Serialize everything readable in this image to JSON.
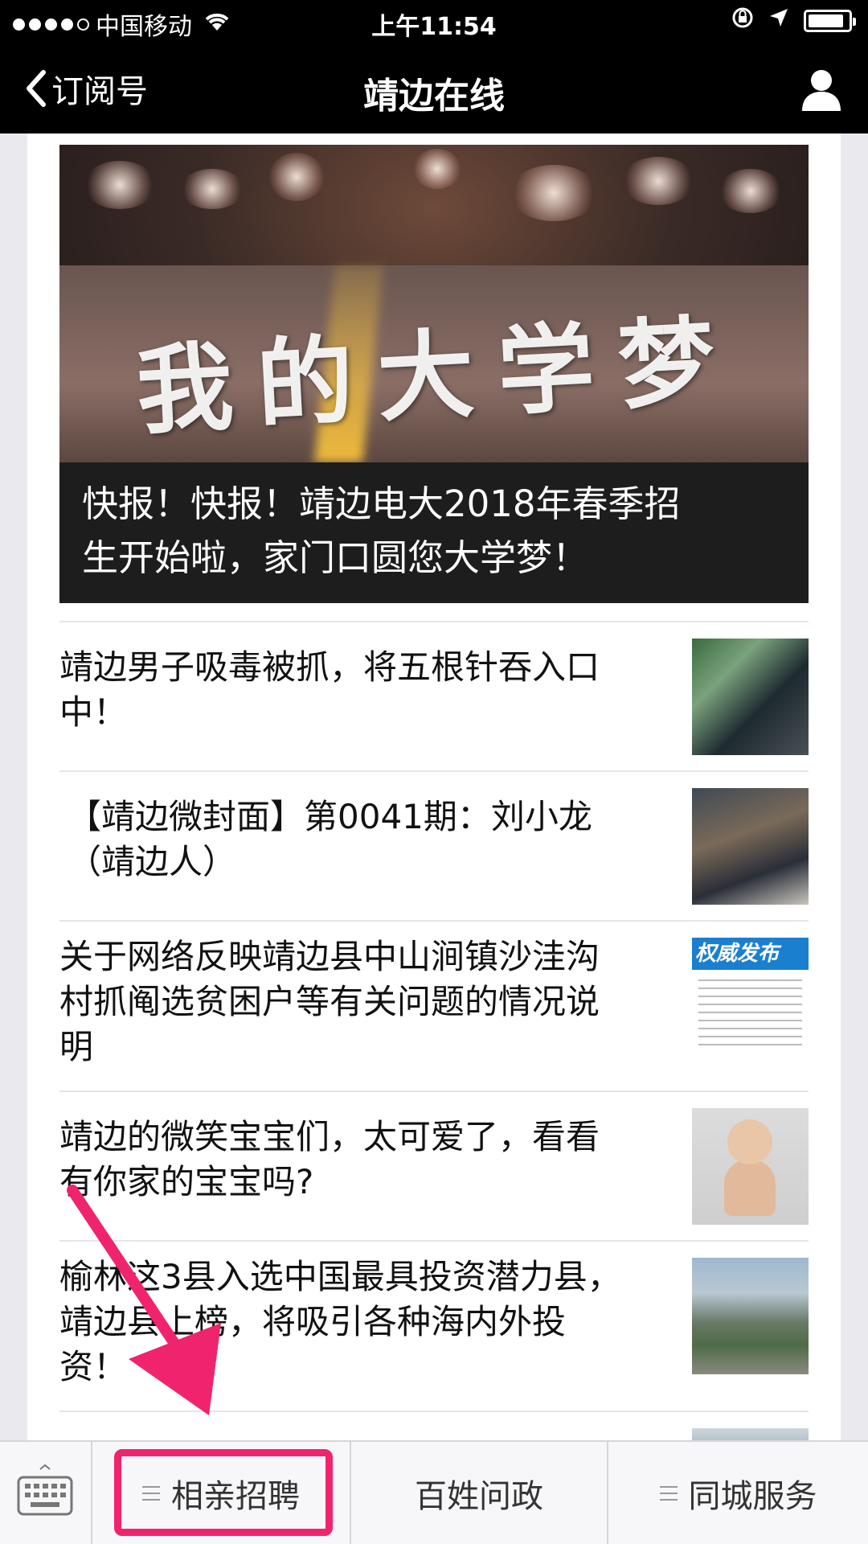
{
  "status_bar": {
    "carrier": "中国移动",
    "time": "上午11:54"
  },
  "nav": {
    "back_label": "订阅号",
    "title": "靖边在线"
  },
  "hero": {
    "image_text": "我的大学梦",
    "caption_line1": "快报！快报！靖边电大2018年春季招",
    "caption_line2": "生开始啦，家门口圆您大学梦！"
  },
  "articles": [
    {
      "title_line1": "靖边男子吸毒被抓，将五根针吞入口",
      "title_line2": "中！",
      "title_line3": ""
    },
    {
      "title_line1": "【靖边微封面】第0041期：刘小龙",
      "title_line2": "（靖边人）",
      "title_line3": ""
    },
    {
      "title_line1": "关于网络反映靖边县中山涧镇沙洼沟",
      "title_line2": "村抓阄选贫困户等有关问题的情况说",
      "title_line3": "明",
      "thumb_banner": "权威发布"
    },
    {
      "title_line1": "靖边的微笑宝宝们，太可爱了，看看",
      "title_line2": "有你家的宝宝吗?",
      "title_line3": ""
    },
    {
      "title_line1": "榆林这3县入选中国最具投资潜力县，",
      "title_line2": "靖边县上榜，将吸引各种海内外投",
      "title_line3": "资！"
    }
  ],
  "menu": {
    "item1": "相亲招聘",
    "item2": "百姓问政",
    "item3": "同城服务"
  },
  "colors": {
    "highlight": "#f0246e",
    "bar_bg": "#000000"
  }
}
